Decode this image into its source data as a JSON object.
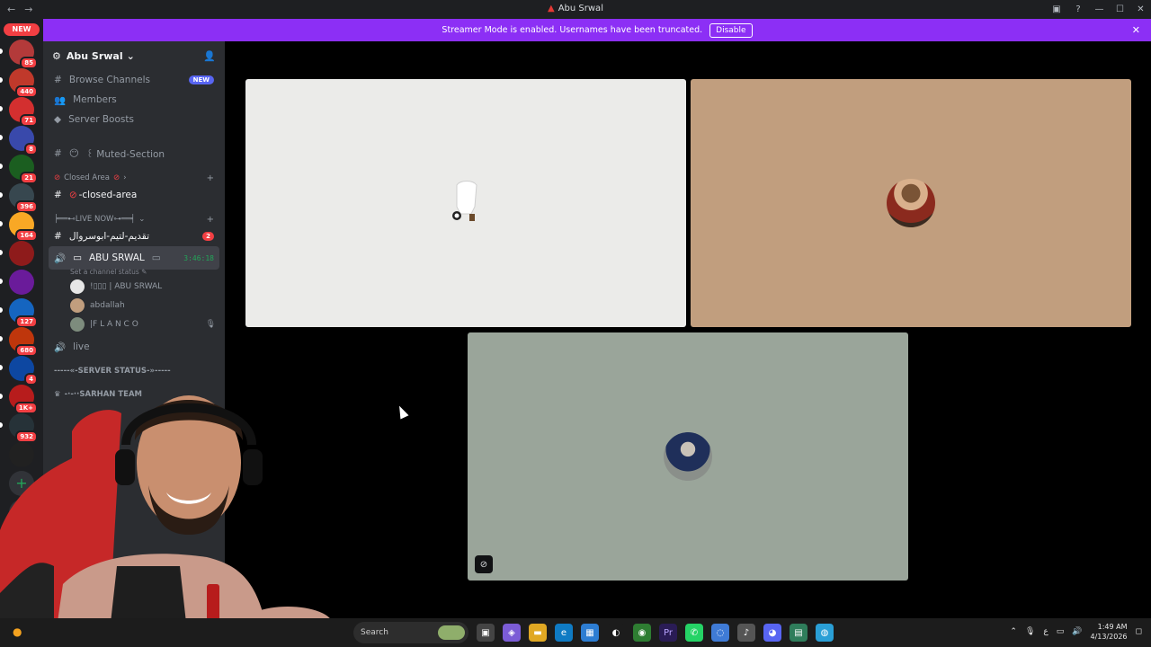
{
  "window": {
    "title": "Abu Srwal",
    "nav_back": "←",
    "nav_forward": "→"
  },
  "banner": {
    "text": "Streamer Mode is enabled. Usernames have been truncated.",
    "button": "Disable"
  },
  "guilds": {
    "new_label": "NEW",
    "badges": [
      "85",
      "440",
      "71",
      "8",
      "21",
      "396",
      "164",
      "",
      "",
      "127",
      "680",
      "4",
      "1K+",
      "932",
      ""
    ]
  },
  "server": {
    "name": "Abu Srwal",
    "browse_channels": "Browse Channels",
    "browse_new": "NEW",
    "members": "Members",
    "server_boosts": "Server Boosts",
    "muted_section": "꒰ Muted-Section",
    "closed_area_category": "Closed Area",
    "closed_area_channel": "-closed-area",
    "live_now_category": "╞══⊷LIVE NOW⊶══╡",
    "arabic_channel": "تقديم-لتيم-ابوسروال",
    "arabic_count": "2",
    "voice_channel": "ABU SRWAL",
    "voice_timer": "3:46:18",
    "channel_status": "Set a channel status",
    "voice_users": [
      "!▯▯▯ | ABU SRWAL",
      "abdallah",
      "|F L A N C O"
    ],
    "live_channel": "live",
    "server_status": "-----«-SERVER STATUS-»-----",
    "sarhan_team": "-·-··SARHAN TEAM"
  },
  "taskbar": {
    "search": "Search",
    "time": "1:49 AM",
    "date": "4/13/2026"
  },
  "colors": {
    "banner": "#8c2ff5",
    "tile1": "#ebebe9",
    "tile2": "#c19e7e",
    "tile3": "#9aa59a"
  }
}
